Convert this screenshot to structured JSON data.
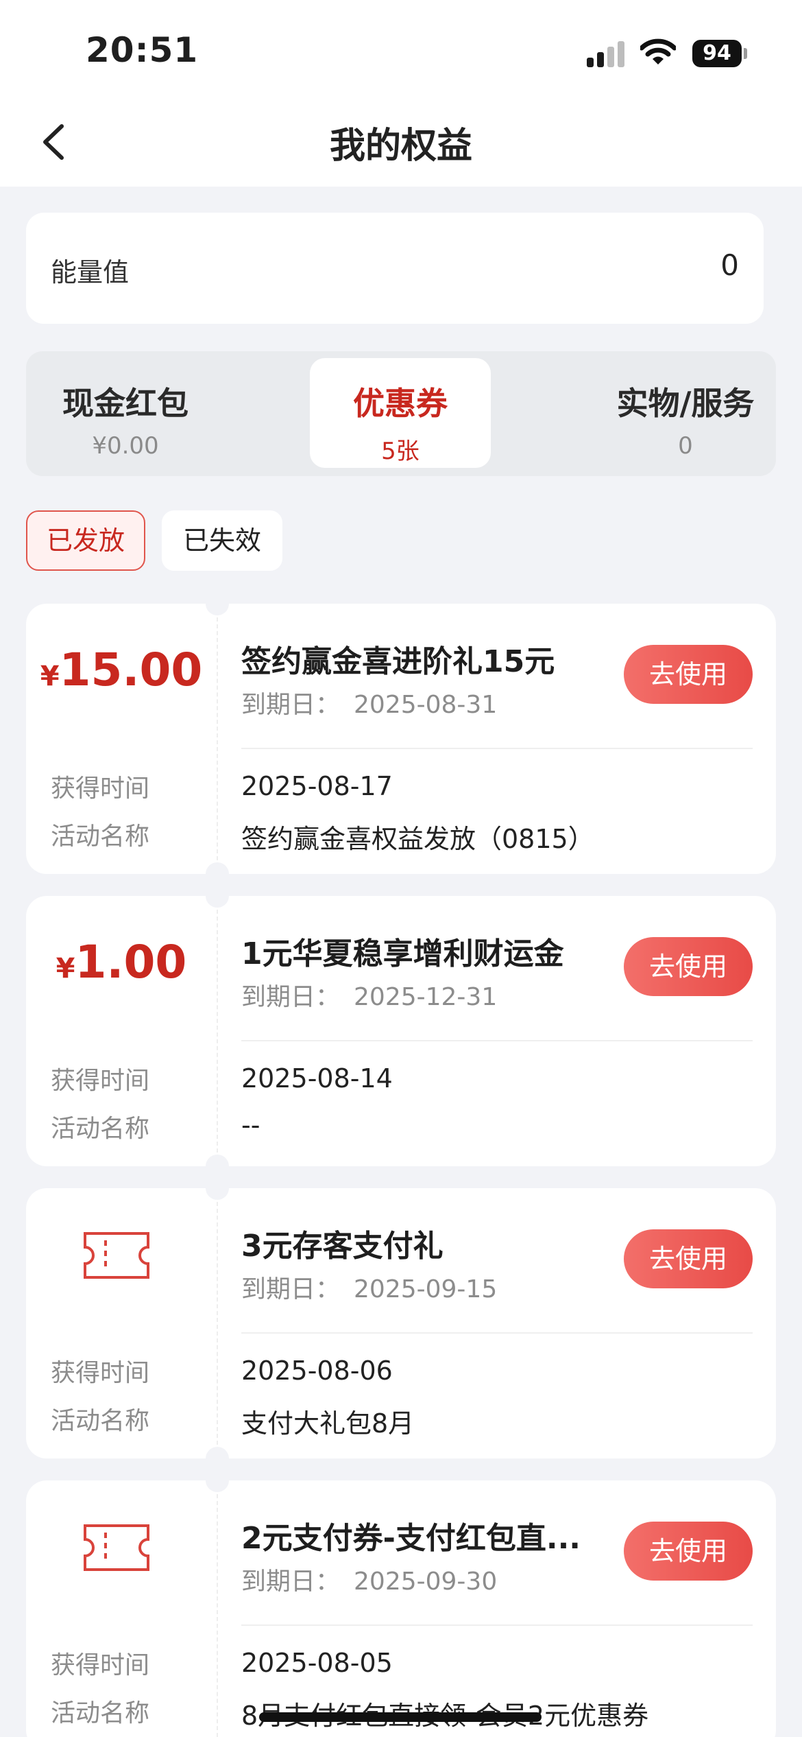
{
  "status_bar": {
    "time": "20:51",
    "battery": "94"
  },
  "nav": {
    "title": "我的权益"
  },
  "energy": {
    "label": "能量值",
    "value": "0"
  },
  "category_tabs": [
    {
      "title": "现金红包",
      "sub": "¥0.00"
    },
    {
      "title": "优惠券",
      "sub": "5张"
    },
    {
      "title": "实物/服务",
      "sub": "0"
    }
  ],
  "filters": {
    "active": "已发放",
    "inactive": "已失效"
  },
  "labels": {
    "expire": "到期日：",
    "obtained": "获得时间",
    "activity": "活动名称",
    "use": "去使用"
  },
  "coupons": [
    {
      "currency": "¥",
      "amount": "15.00",
      "title": "签约赢金喜进阶礼15元",
      "expire": "2025-08-31",
      "obtained": "2025-08-17",
      "activity": "签约赢金喜权益发放（0815）"
    },
    {
      "currency": "¥",
      "amount": "1.00",
      "title": "1元华夏稳享增利财运金",
      "expire": "2025-12-31",
      "obtained": "2025-08-14",
      "activity": "--"
    },
    {
      "icon": "ticket-icon",
      "title": "3元存客支付礼",
      "expire": "2025-09-15",
      "obtained": "2025-08-06",
      "activity": "支付大礼包8月"
    },
    {
      "icon": "ticket-icon",
      "title": "2元支付券-支付红包直...",
      "expire": "2025-09-30",
      "obtained": "2025-08-05",
      "activity": "8月支付红包直接领-会员2元优惠券"
    }
  ],
  "colors": {
    "accent": "#c8281f",
    "button": "#e84b47",
    "background": "#f2f3f7"
  }
}
